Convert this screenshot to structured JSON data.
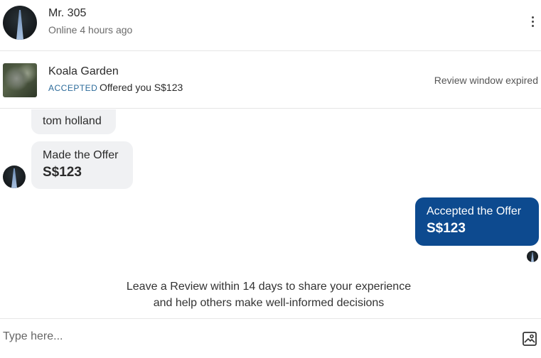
{
  "header": {
    "name": "Mr. 305",
    "status": "Online 4 hours ago",
    "avatar_icon": "profile-photo-icon",
    "more_icon": "more-vertical-icon"
  },
  "listing": {
    "title": "Koala Garden",
    "badge": "ACCEPTED",
    "offer_text": "Offered you S$123",
    "review_status": "Review window expired",
    "thumbnail_icon": "listing-photo-icon"
  },
  "messages": {
    "name_message": "tom holland",
    "offer_label": "Made the Offer",
    "offer_amount": "S$123",
    "accept_label": "Accepted the Offer",
    "accept_amount": "S$123"
  },
  "review_prompt": {
    "line1": "Leave a Review within 14 days to share your experience",
    "line2": "and help others make well-informed decisions"
  },
  "composer": {
    "placeholder": "Type here...",
    "value": "",
    "image_icon": "image-upload-icon"
  },
  "colors": {
    "accent": "#0d4a8f",
    "badge": "#2c6b9a",
    "bubble_in": "#f0f1f3"
  }
}
